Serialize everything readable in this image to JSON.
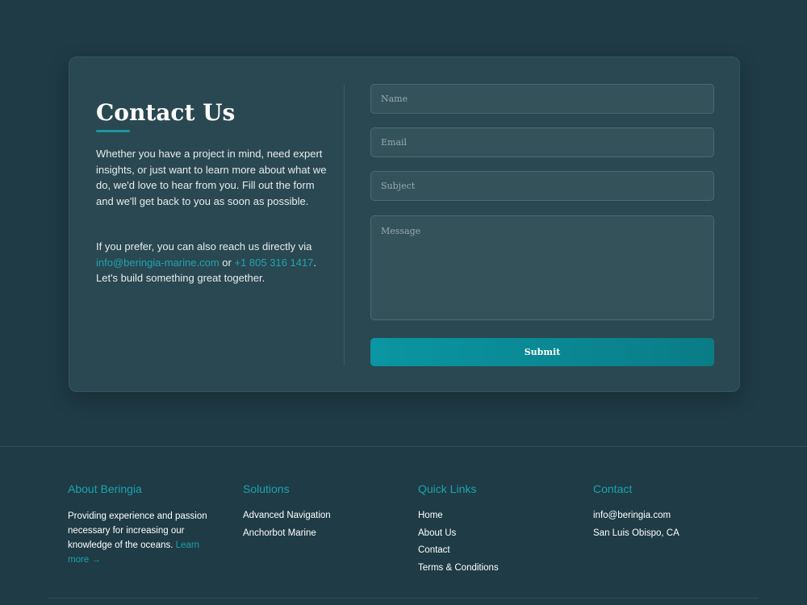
{
  "contact": {
    "title": "Contact Us",
    "intro": "Whether you have a project in mind, need expert insights, or just want to learn more about what we do, we'd love to hear from you. Fill out the form and we'll get back to you as soon as possible.",
    "reach_prefix": "If you prefer, you can also reach us directly via ",
    "email": "info@beringia-marine.com",
    "or": " or ",
    "phone": "+1 805 316 1417",
    "reach_suffix": ". Let's build something great together."
  },
  "form": {
    "name_placeholder": "Name",
    "email_placeholder": "Email",
    "subject_placeholder": "Subject",
    "message_placeholder": "Message",
    "submit_label": "Submit"
  },
  "footer": {
    "about": {
      "heading": "About Beringia",
      "text": "Providing experience and passion necessary for increasing our knowledge of the oceans.",
      "learn_more": "Learn more →"
    },
    "solutions": {
      "heading": "Solutions",
      "items": [
        "Advanced Navigation",
        "Anchorbot Marine"
      ]
    },
    "quick_links": {
      "heading": "Quick Links",
      "items": [
        "Home",
        "About Us",
        "Contact",
        "Terms & Conditions"
      ]
    },
    "contact": {
      "heading": "Contact",
      "items": [
        "info@beringia.com",
        "San Luis Obispo, CA"
      ]
    }
  },
  "colors": {
    "background": "#1f3b45",
    "card": "#2a4851",
    "accent": "#1ba3af"
  }
}
